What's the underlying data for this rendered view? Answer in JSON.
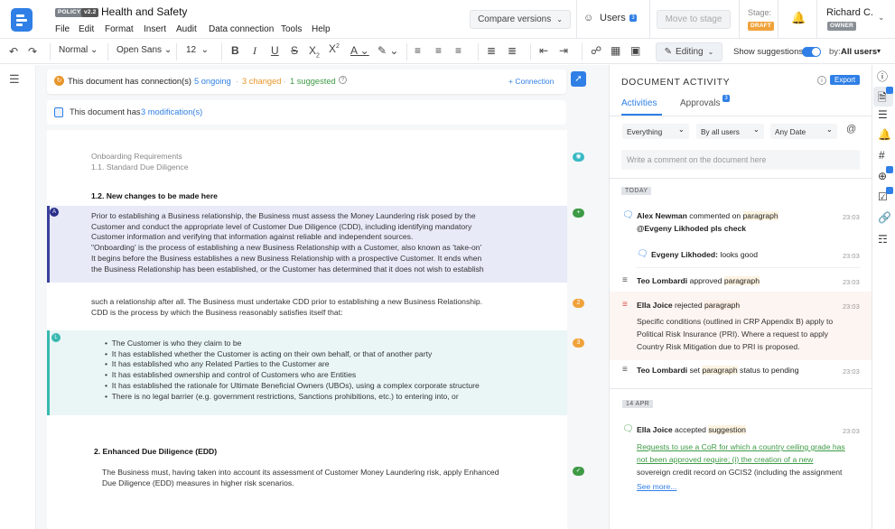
{
  "header": {
    "badge_policy": "POLICY",
    "badge_version": "v2.2",
    "title": "Health and Safety",
    "menu": [
      "File",
      "Edit",
      "Format",
      "Insert",
      "Audit",
      "Data connection",
      "Tools",
      "Help"
    ],
    "compare_label": "Compare versions",
    "users_label": "Users",
    "users_count": "3",
    "move_stage_label": "Move to stage",
    "stage_label": "Stage:",
    "stage_value": "DRAFT",
    "user_name": "Richard C.",
    "user_role": "OWNER"
  },
  "toolbar": {
    "style": "Normal",
    "font": "Open Sans",
    "size": "12",
    "editing_label": "Editing",
    "show_suggestions_label": "Show suggestions",
    "by_label": "by:",
    "by_value": "All users"
  },
  "connections": {
    "prefix": "This document has connection(s)",
    "ongoing": "5 ongoing",
    "changed": "3 changed",
    "suggested": "1 suggested",
    "connection_button": "+ Connection"
  },
  "modifications": {
    "prefix": "This document has",
    "link": "3 modification(s)"
  },
  "document": {
    "breadcrumb1": "Onboarding Requirements",
    "breadcrumb2": "1.1. Standard Due Diligence",
    "heading1": "1.2. New changes to be made here",
    "para1": [
      "Prior to establishing a Business relationship, the Business must assess the Money Laundering risk posed by the",
      "Customer and conduct the appropriate level of Customer Due Diligence (CDD), including identifying mandatory",
      "Customer information and verifying that information against reliable and independent sources.",
      "\"Onboarding' is the process of establishing a new Business Relationship with a Customer, also known as 'take-on'",
      "It begins before the Business establishes a new Business Relationship with a prospective Customer. It ends when",
      "the Business Relationship has been established, or the Customer has determined that it does not wish to establish"
    ],
    "para2": [
      "such a relationship after all. The Business must undertake CDD prior to establishing a new Business Relationship.",
      "CDD is the process by which the Business reasonably satisfies itself that:"
    ],
    "bullets": [
      "The Customer is who they claim to be",
      "It has established whether the Customer is acting on their own behalf, or that of another party",
      "It has established who any Related Parties to the Customer are",
      "It has established ownership and control of Customers who are Entities",
      "It has established the rationale for Ultimate Beneficial Owners (UBOs), using a complex corporate structure",
      "There is no legal barrier (e.g. government restrictions, Sanctions prohibitions, etc.) to entering into, or"
    ],
    "heading2": "2. Enhanced Due Diligence (EDD)",
    "para3": [
      "The Business must, having taken into account its assessment of Customer Money Laundering risk, apply Enhanced",
      "Due Diligence (EDD) measures in higher risk scenarios."
    ],
    "marker_a": "A",
    "marker_l": "L",
    "marker_count1": "2",
    "marker_count2": "3"
  },
  "panel": {
    "title": "DOCUMENT ACTIVITY",
    "export_label": "Export",
    "tab_activities": "Activities",
    "tab_approvals": "Approvals",
    "approvals_count": "3",
    "filter_everything": "Everything",
    "filter_users": "By all users",
    "filter_date": "Any Date",
    "comment_placeholder": "Write a comment on the document here",
    "today": "TODAY",
    "apr": "14 APR",
    "a1_name": "Alex Newman",
    "a1_action": "commented on",
    "a1_target": "paragraph",
    "a1_time": "23:03",
    "a1_comment": "@Evgeny Likhoded pls check",
    "r1_name": "Evgeny Likhoded:",
    "r1_text": "looks good",
    "r1_time": "23:03",
    "a2_name": "Teo Lombardi",
    "a2_action": "approved",
    "a2_target": "paragraph",
    "a2_time": "23:03",
    "a3_name": "Ella Joice",
    "a3_action": "rejected",
    "a3_target": "paragraph",
    "a3_time": "23:03",
    "a3_text": [
      "Specific conditions (outlined in CRP Appendix B) apply to",
      "Political Risk Insurance (PRI). Where a request to apply",
      "Country Risk Mitigation due to PRI is proposed."
    ],
    "a4_name": "Teo Lombardi",
    "a4_action": "set",
    "a4_target": "paragraph",
    "a4_rest": "status to pending",
    "a4_time": "23:03",
    "a5_name": "Ella Joice",
    "a5_action": "accepted",
    "a5_target": "suggestion",
    "a5_time": "23:03",
    "a5_text": [
      "Requests to use a CoR for which a country ceiling grade has",
      "not been approved require; (i) the creation of a new",
      "sovereign credit record on GCIS2 (including the assignment"
    ],
    "see_more": "See more..."
  },
  "colors": {
    "accent": "#2f7fe6",
    "suggestion_bg": "#e8eaf8",
    "changed": "#e8952a",
    "approved": "#3d9a45"
  }
}
